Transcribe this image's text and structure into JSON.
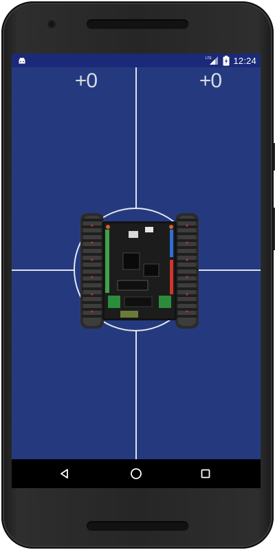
{
  "status_bar": {
    "app_icon": "android-icon",
    "network_label": "LTE",
    "signal_icon": "cell-signal-icon",
    "battery_icon": "battery-charging-icon",
    "time": "12:24",
    "background_color": "#1b2a78"
  },
  "control_pad": {
    "background_color": "#253a7e",
    "left_counter": "+0",
    "right_counter": "+0",
    "joystick_image": "robot-tank-chassis"
  },
  "nav_bar": {
    "back_icon": "back-triangle-icon",
    "home_icon": "home-circle-icon",
    "recents_icon": "recents-square-icon"
  }
}
